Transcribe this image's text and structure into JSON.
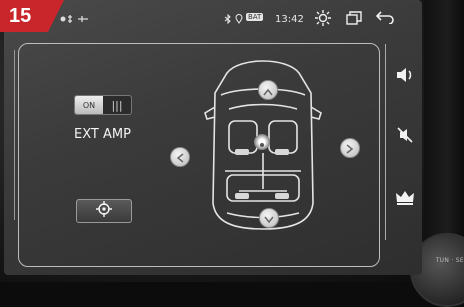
{
  "badge": {
    "number": "15",
    "color": "#c8262b"
  },
  "status_bar": {
    "time": "13:42",
    "battery_label": "BAT",
    "icons": [
      "bluetooth-icon",
      "location-icon",
      "battery-icon",
      "brightness-icon",
      "window-icon",
      "back-icon"
    ]
  },
  "amp_panel": {
    "toggle_on_label": "ON",
    "toggle_grip": "|||",
    "ext_amp_label": "EXT AMP",
    "target_icon": "crosshair-icon"
  },
  "car_diagram": {
    "arrows": [
      "arrow-up-icon",
      "arrow-left-icon",
      "arrow-right-icon",
      "arrow-down-icon"
    ],
    "center_icon": "listening-point-icon"
  },
  "right_toolbar": {
    "items": [
      "volume-icon",
      "mute-icon",
      "crown-icon"
    ]
  },
  "device": {
    "knob_label": "TUN · SE"
  }
}
